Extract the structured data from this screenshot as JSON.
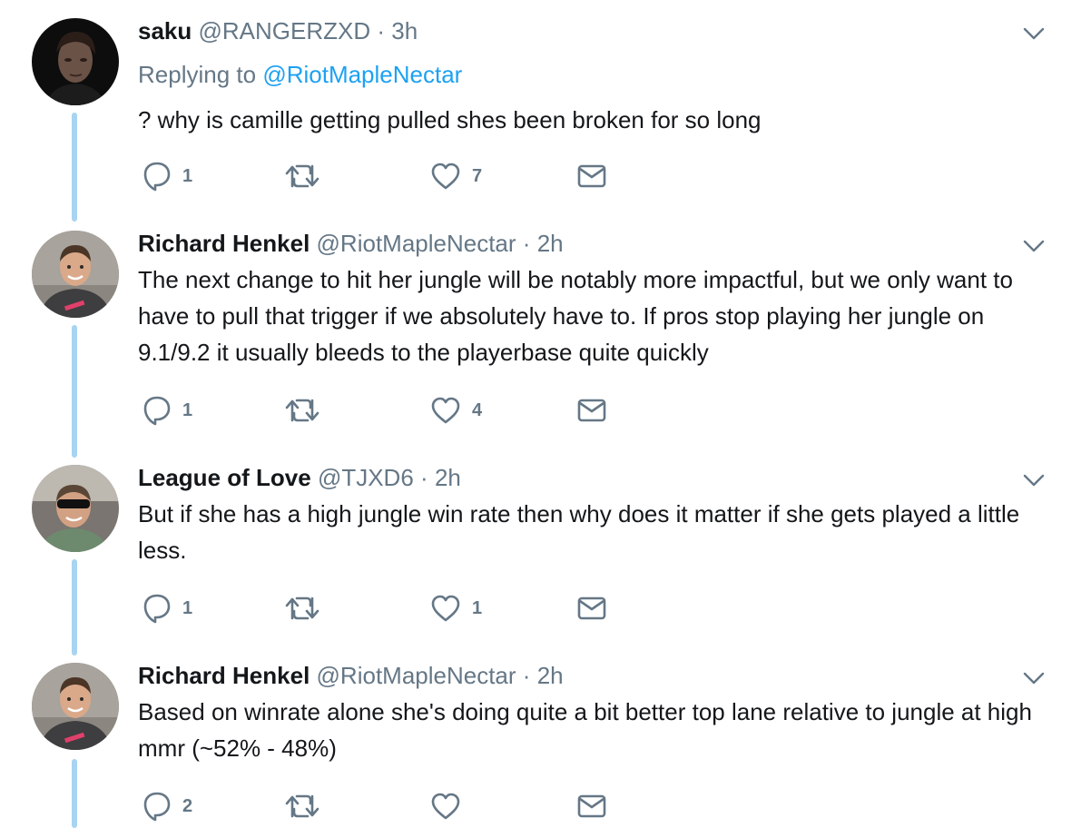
{
  "colors": {
    "text": "#14171a",
    "secondary": "#657786",
    "link": "#1da1f2",
    "thread_line": "#a8d4f1"
  },
  "icons": {
    "reply": "reply-icon",
    "retweet": "retweet-icon",
    "like": "heart-icon",
    "dm": "envelope-icon",
    "more": "chevron-down-icon"
  },
  "tweets": [
    {
      "name": "saku",
      "handle": "@RANGERZXD",
      "separator": "·",
      "time": "3h",
      "replying_prefix": "Replying to",
      "replying_handle": "@RiotMapleNectar",
      "text": "? why is camille getting pulled shes been broken for so long",
      "reply_count": "1",
      "retweet_count": "",
      "like_count": "7"
    },
    {
      "name": "Richard Henkel",
      "handle": "@RiotMapleNectar",
      "separator": "·",
      "time": "2h",
      "text": "The next change to hit her jungle will be notably more impactful, but we only want to have to pull that trigger if we absolutely have to. If pros stop playing her jungle on 9.1/9.2 it usually bleeds to the playerbase quite quickly",
      "reply_count": "1",
      "retweet_count": "",
      "like_count": "4"
    },
    {
      "name": "League of Love",
      "handle": "@TJXD6",
      "separator": "·",
      "time": "2h",
      "text": "But if she has a high jungle win rate then why does it matter if she gets played a little less.",
      "reply_count": "1",
      "retweet_count": "",
      "like_count": "1"
    },
    {
      "name": "Richard Henkel",
      "handle": "@RiotMapleNectar",
      "separator": "·",
      "time": "2h",
      "text": "Based on winrate alone she's doing quite a bit better top lane relative to jungle at high mmr (~52% - 48%)",
      "reply_count": "2",
      "retweet_count": "",
      "like_count": ""
    }
  ]
}
